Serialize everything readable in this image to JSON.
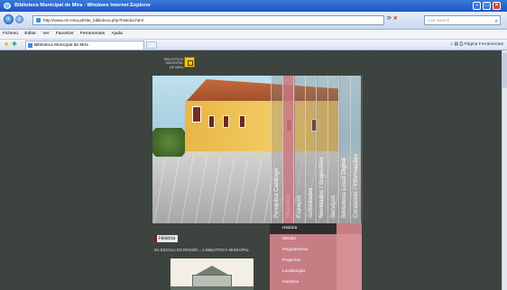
{
  "window": {
    "title": "Biblioteca Municipal de Mira - Windows Internet Explorer",
    "controls": [
      "minimize",
      "maximize",
      "close"
    ]
  },
  "address_bar": {
    "url": "http://www.cm-mira.pt/site_biblioteca.php?historia.html",
    "search_placeholder": "Live Search"
  },
  "menu": {
    "items": [
      "Ficheiro",
      "Editar",
      "Ver",
      "Favoritos",
      "Ferramentas",
      "Ajuda"
    ]
  },
  "tabs": {
    "items": [
      {
        "label": "Biblioteca Municipal de Mira"
      }
    ],
    "commands": [
      "Página",
      "Ferramentas"
    ]
  },
  "site": {
    "logo_text": "BIBLIOTECA\nMUNICIPAL\nDE MIRA",
    "nav_items": [
      {
        "label": "Pesquisa Catálogo",
        "active": false
      },
      {
        "label": "Histórico",
        "active": true
      },
      {
        "label": "Espaços",
        "active": false
      },
      {
        "label": "Actividades",
        "active": false
      },
      {
        "label": "Novidades / Sugestões",
        "active": false
      },
      {
        "label": "Serviços",
        "active": false
      },
      {
        "label": "Biblioteca Local Digital",
        "active": false
      },
      {
        "label": "Contactos / Informações",
        "active": false
      }
    ],
    "section_title": "História",
    "section_text": "DA ESCOLA DO ROSSIO... À BIBLIOTECA MUNICIPAL",
    "submenu": [
      {
        "label": "História",
        "active": true
      },
      {
        "label": "Missão",
        "active": false
      },
      {
        "label": "Regulamento",
        "active": false
      },
      {
        "label": "Projectos",
        "active": false
      },
      {
        "label": "Localização",
        "active": false
      },
      {
        "label": "Horários",
        "active": false
      }
    ]
  },
  "colors": {
    "page_bg": "#3d433f",
    "accent_rose": "#c67e84",
    "ie_blue": "#1f55c6"
  }
}
